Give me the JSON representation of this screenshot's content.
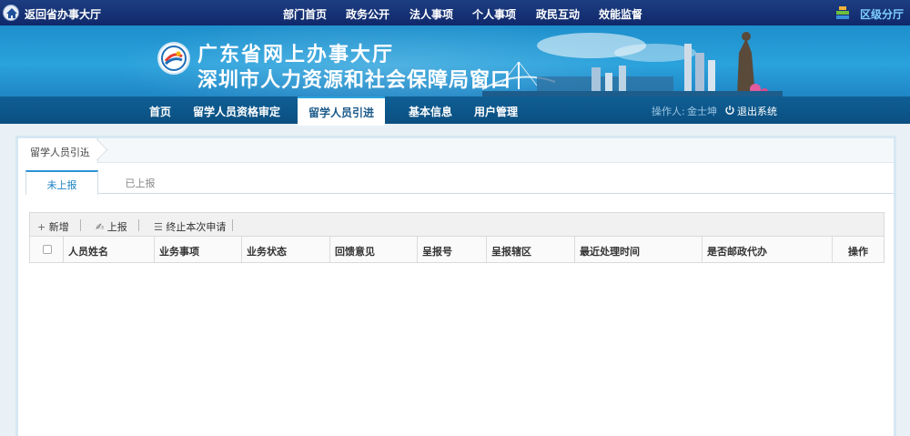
{
  "topbar": {
    "back_label": "返回省办事大厅",
    "nav": [
      "部门首页",
      "政务公开",
      "法人事项",
      "个人事项",
      "政民互动",
      "效能监督"
    ],
    "region_label": "区级分厅"
  },
  "banner": {
    "title_line1": "广东省网上办事大厅",
    "title_line2": "深圳市人力资源和社会保障局窗口"
  },
  "main_nav": {
    "items": [
      "首页",
      "留学人员资格审定",
      "留学人员引进",
      "基本信息",
      "用户管理"
    ],
    "active_index": 2,
    "operator_label": "操作人:",
    "operator_name": "金士坤",
    "logout_label": "退出系统"
  },
  "breadcrumb": "留学人员引进",
  "subtabs": [
    "未上报",
    "已上报"
  ],
  "toolbar": [
    "新增",
    "上报",
    "终止本次申请"
  ],
  "table": {
    "columns": [
      "人员姓名",
      "业务事项",
      "业务状态",
      "回馈意见",
      "呈报号",
      "呈报辖区",
      "最近处理时间",
      "是否邮政代办",
      "操作"
    ],
    "rows": []
  },
  "colors": {
    "topbar": "#10286a",
    "banner": "#2aa2dc",
    "nav": "#0b4f80",
    "accent": "#1b82c4"
  }
}
